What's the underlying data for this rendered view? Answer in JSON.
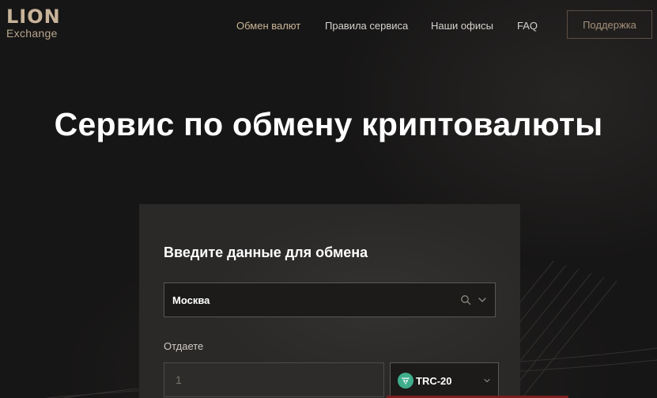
{
  "brand": {
    "name": "LION",
    "sub": "Exchange"
  },
  "nav": {
    "items": [
      {
        "label": "Обмен валют",
        "active": true
      },
      {
        "label": "Правила сервиса",
        "active": false
      },
      {
        "label": "Наши офисы",
        "active": false
      },
      {
        "label": "FAQ",
        "active": false
      }
    ],
    "support_label": "Поддержка"
  },
  "hero": {
    "title": "Сервис по обмену криптовалюты"
  },
  "exchange_form": {
    "title": "Введите данные для обмена",
    "city": {
      "value": "Москва",
      "icons": [
        "search-icon",
        "chevron-down-icon"
      ]
    },
    "give": {
      "label": "Отдаете",
      "amount_placeholder": "1",
      "currency": "TRC-20",
      "currency_icon": "tether-icon"
    }
  },
  "colors": {
    "background": "#171616",
    "card": "#2a2928",
    "accent": "#c9b596",
    "tether": "#3fae8c"
  }
}
